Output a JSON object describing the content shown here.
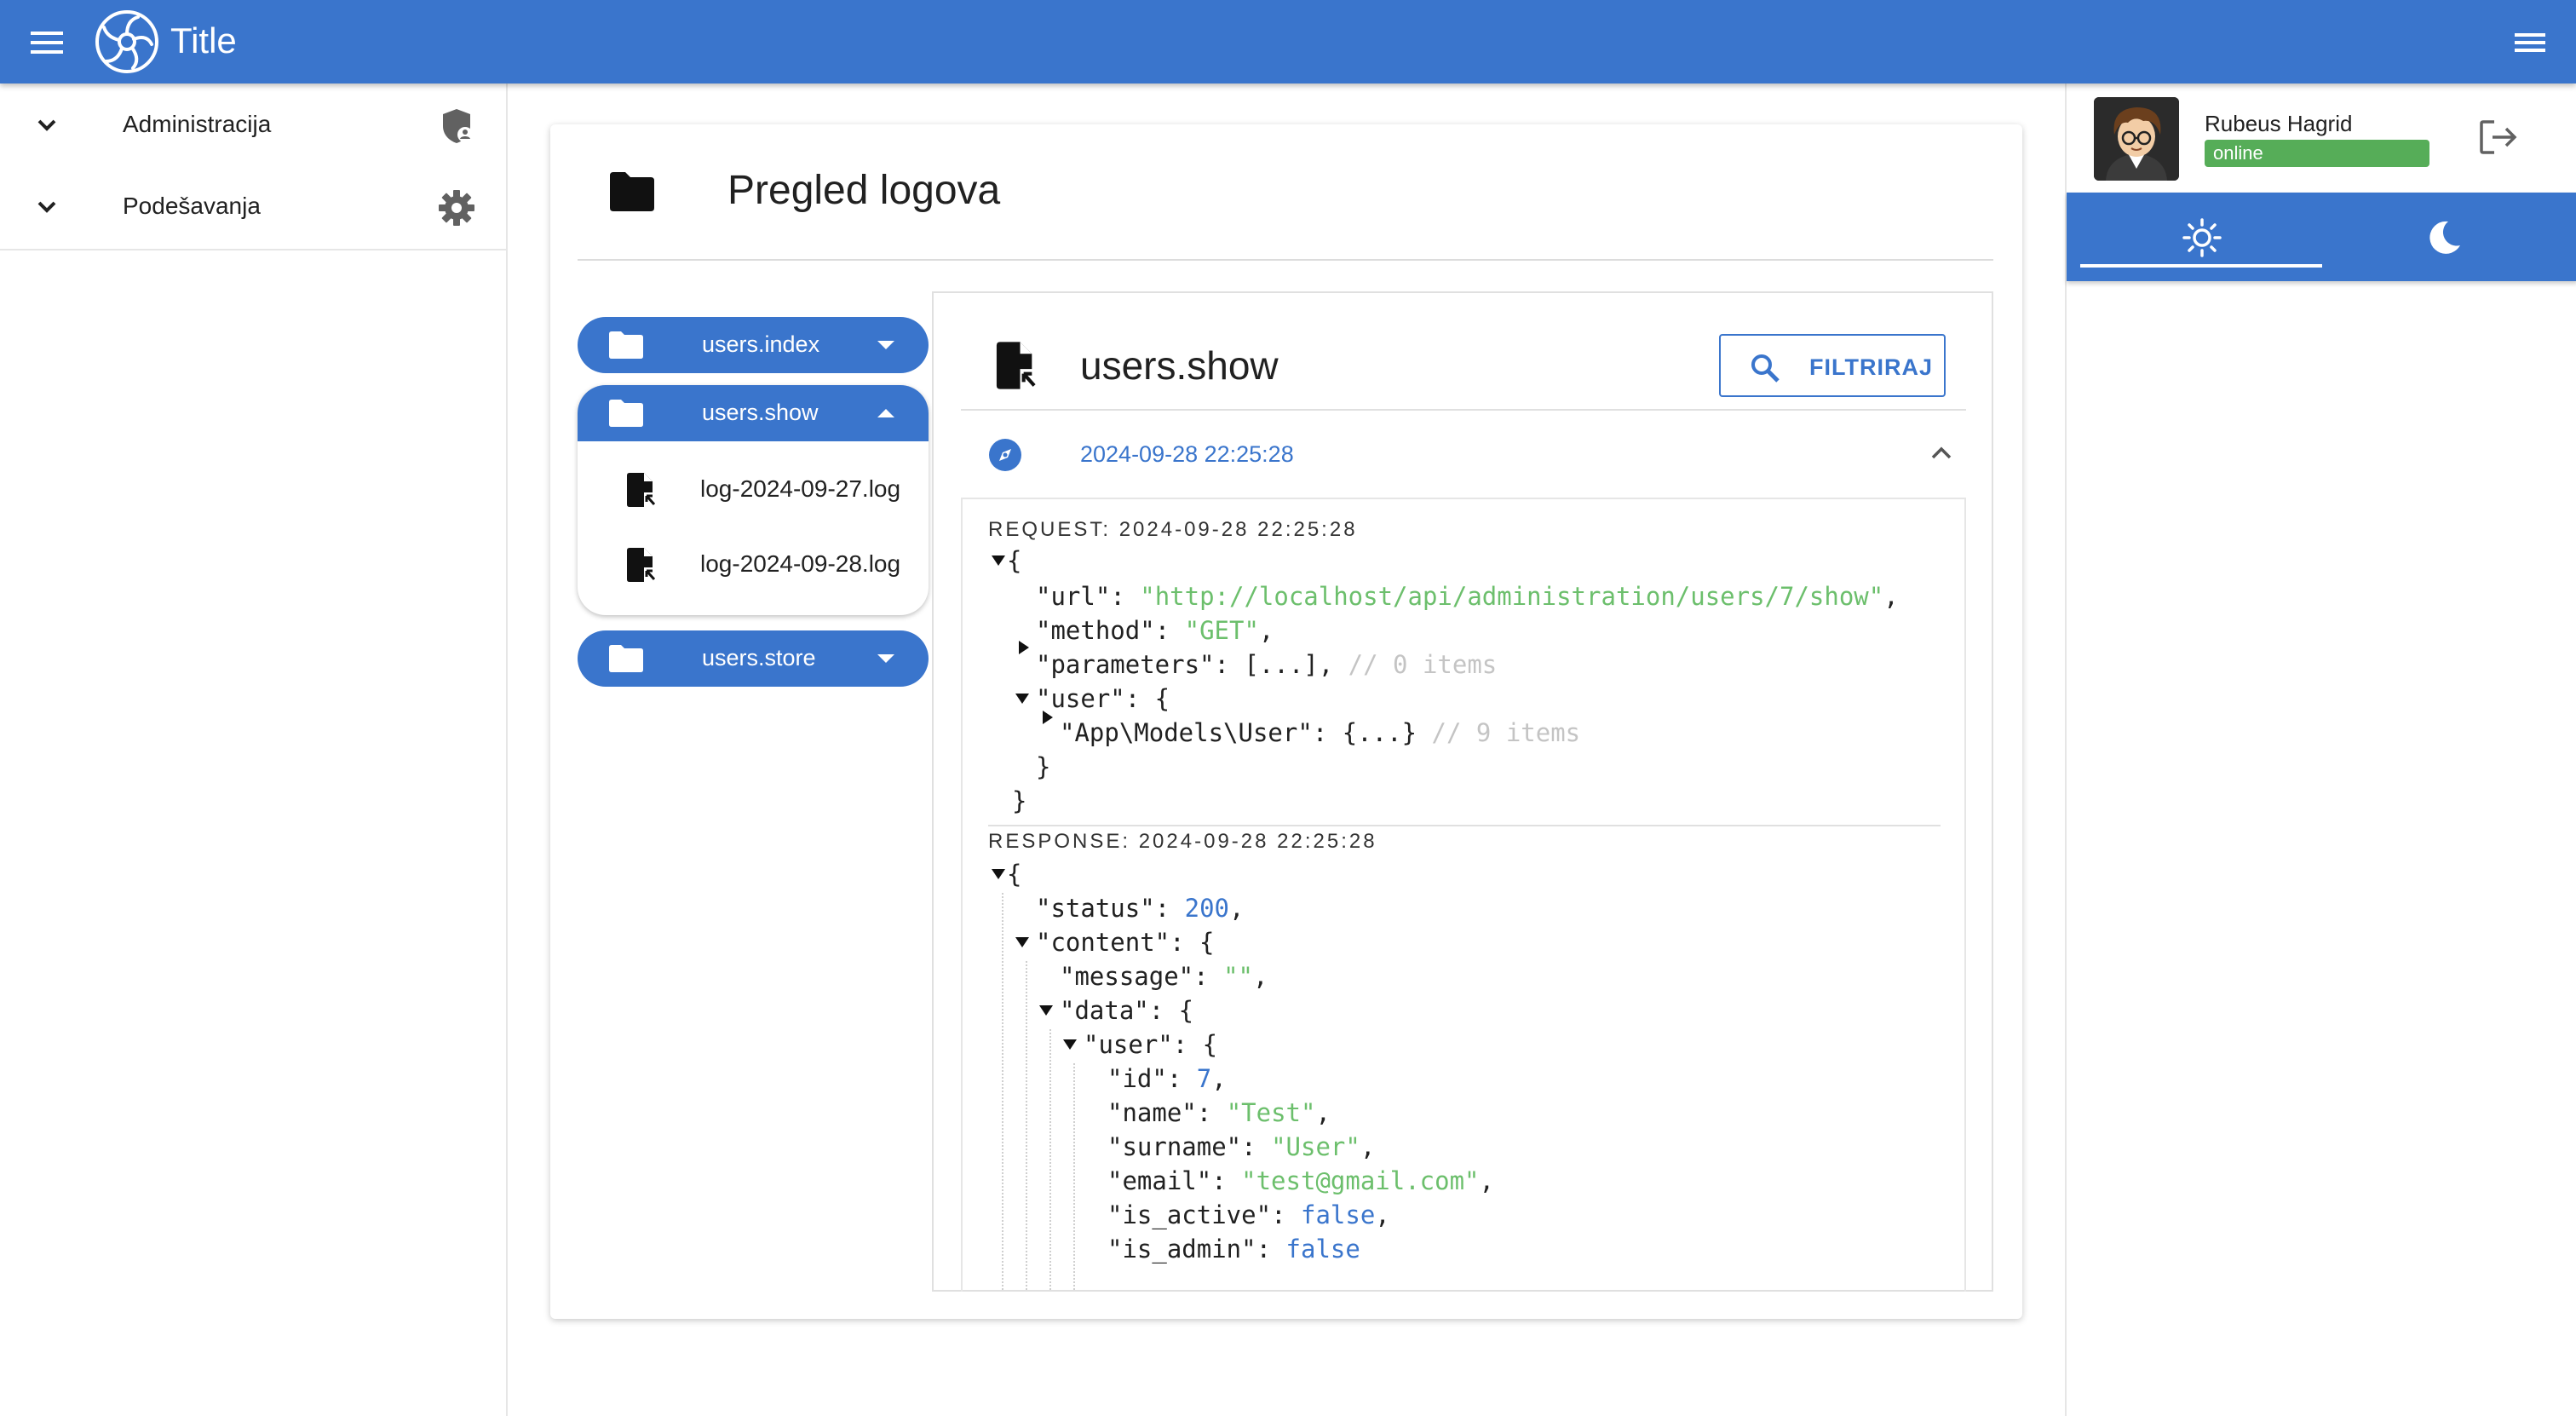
{
  "app": {
    "title": "Title"
  },
  "colors": {
    "primary": "#3a75cc",
    "string": "#6cbf6c",
    "number": "#3a75cc",
    "comment": "#c4c4c4",
    "online": "#56ad58"
  },
  "nav": {
    "items": [
      {
        "label": "Administracija",
        "icon": "shield-person-icon"
      },
      {
        "label": "Podešavanja",
        "icon": "gear-icon"
      }
    ]
  },
  "main": {
    "title": "Pregled logova",
    "routes": [
      {
        "label": "users.index",
        "expanded": false
      },
      {
        "label": "users.show",
        "expanded": true,
        "files": [
          "log-2024-09-27.log",
          "log-2024-09-28.log"
        ]
      },
      {
        "label": "users.store",
        "expanded": false
      }
    ],
    "detail": {
      "title": "users.show",
      "filter_label": "FILTRIRAJ",
      "entry": {
        "timestamp": "2024-09-28 22:25:28",
        "request_label": "REQUEST: 2024-09-28 22:25:28",
        "response_label": "RESPONSE: 2024-09-28 22:25:28",
        "request": {
          "url_key": "\"url\"",
          "url": "\"http://localhost/api/administration/users/7/show\"",
          "method_key": "\"method\"",
          "method": "\"GET\"",
          "parameters_key": "\"parameters\"",
          "parameters_value": "[...],",
          "parameters_comment": "// 0 items",
          "user_key": "\"user\"",
          "model_key": "\"App\\Models\\User\"",
          "model_value": "{...}",
          "model_comment": "// 9 items"
        },
        "response": {
          "status_key": "\"status\"",
          "status": "200",
          "content_key": "\"content\"",
          "message_key": "\"message\"",
          "message": "\"\"",
          "data_key": "\"data\"",
          "user_key": "\"user\"",
          "id_key": "\"id\"",
          "id": "7",
          "name_key": "\"name\"",
          "name": "\"Test\"",
          "surname_key": "\"surname\"",
          "surname": "\"User\"",
          "email_key": "\"email\"",
          "email": "\"test@gmail.com\"",
          "is_active_key": "\"is_active\"",
          "is_active": "false",
          "is_admin_key": "\"is_admin\"",
          "is_admin": "false"
        }
      }
    }
  },
  "profile": {
    "name": "Rubeus Hagrid",
    "status": "online"
  },
  "theme": {
    "active": "light",
    "options": [
      "sun-icon",
      "moon-icon"
    ]
  }
}
